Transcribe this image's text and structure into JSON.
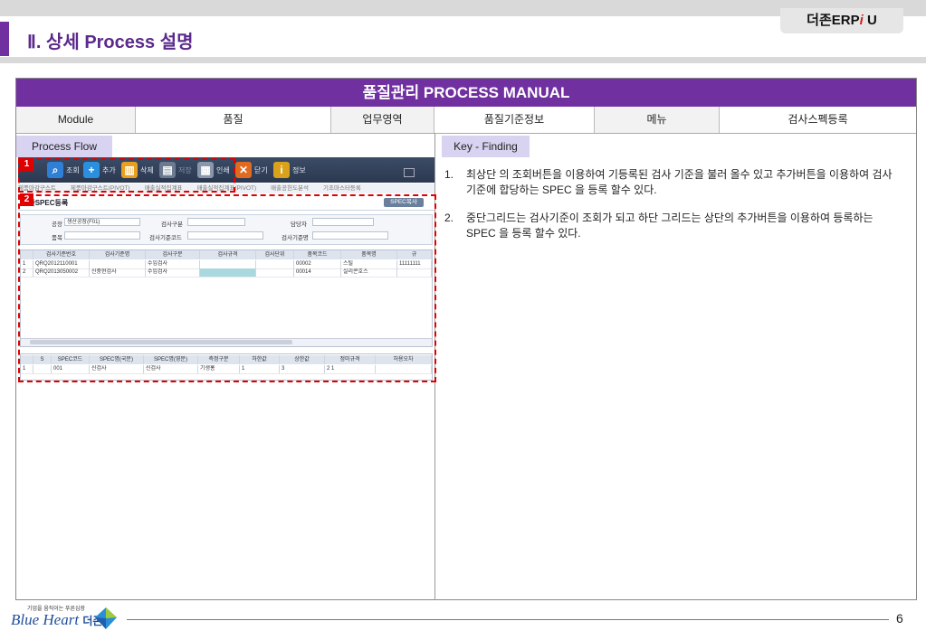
{
  "brand": {
    "prefix": "더존ERP",
    "i": "i",
    "suffix": "U"
  },
  "page_title": "Ⅱ. 상세 Process 설명",
  "manual": {
    "header": "품질관리 PROCESS MANUAL",
    "info": [
      {
        "label": "Module",
        "value": "품질"
      },
      {
        "label": "업무영역",
        "value": "품질기준정보"
      },
      {
        "label": "메뉴",
        "value": "검사스펙등록"
      }
    ],
    "process_flow_label": "Process Flow",
    "key_finding_label": "Key - Finding",
    "findings": [
      {
        "num": "1.",
        "text": "최상단 의 조회버튼을 이용하여 기등록된 검사 기준을 불러 올수 있고 추가버튼을 이용하여 검사기준에 합당하는 SPEC 을 등록 할수 있다."
      },
      {
        "num": "2.",
        "text": "중단그리드는 검사기준이 조회가 되고 하단 그리드는 상단의 추가버튼을 이용하여 등록하는 SPEC 을 등록 할수 있다."
      }
    ]
  },
  "app": {
    "toolbar": [
      {
        "label": "조회",
        "icon": "search-icon",
        "color": "#2f7fd6",
        "glyph": "⌕"
      },
      {
        "label": "추가",
        "icon": "plus-icon",
        "color": "#2b8fe0",
        "glyph": "+"
      },
      {
        "label": "삭제",
        "icon": "trash-icon",
        "color": "#e8a020",
        "glyph": "▥"
      },
      {
        "label": "저장",
        "icon": "save-icon",
        "color": "#6c7a90",
        "glyph": "▤"
      },
      {
        "label": "인쇄",
        "icon": "print-icon",
        "color": "#8a96aa",
        "glyph": "▦"
      },
      {
        "label": "닫기",
        "icon": "close-icon",
        "color": "#e06a20",
        "glyph": "✕"
      },
      {
        "label": "정보",
        "icon": "info-book-icon",
        "color": "#d9a21a",
        "glyph": "i"
      }
    ],
    "tabs": [
      "제품마감구스트",
      "제품마감구스트(PIVOT)",
      "매출실적집계표",
      "매출실적집계표(PIVOT)",
      "매출공헌도분석",
      "기초마스터등록"
    ],
    "form_title": "검사SPEC등록",
    "spec_copy": "SPEC복사",
    "search": {
      "plant_label": "공장",
      "plant_value": "생산공장(F01)",
      "type_label": "검사구분",
      "type_value": "",
      "owner_label": "담당자",
      "owner_value": "",
      "item_label": "품목",
      "item_value": "",
      "std_code_label": "검사기준코드",
      "std_code_value": "",
      "std_name_label": "검사기준명",
      "std_name_value": ""
    },
    "grid1": {
      "columns": [
        "",
        "검사기준번호",
        "검사기준명",
        "검사구분",
        "검사규격",
        "검사단위",
        "품목코드",
        "품목명",
        "규"
      ],
      "rows": [
        [
          "1",
          "QRQ2012110001",
          "",
          "수입검사",
          "",
          "",
          "00002",
          "스틸",
          "11111111"
        ],
        [
          "2",
          "QRQ2013050002",
          "신중현검사",
          "수입검사",
          "",
          "",
          "00014",
          "실리콘호스",
          ""
        ]
      ]
    },
    "grid2": {
      "columns": [
        "",
        "S",
        "SPEC코드",
        "SPEC명(국문)",
        "SPEC명(영문)",
        "측정구분",
        "하한값",
        "상한값",
        "정미규격",
        "허용오차"
      ],
      "rows": [
        [
          "1",
          "",
          "001",
          "신검사",
          "신검사",
          "기생홍",
          "1",
          "3",
          "2 1",
          ""
        ]
      ]
    },
    "badges": [
      "1",
      "2"
    ]
  },
  "footer": {
    "slogan": "기업을 움직이는 푸른심장",
    "logo_text": "Blue Heart",
    "logo_kor": "더존",
    "page_number": "6"
  }
}
